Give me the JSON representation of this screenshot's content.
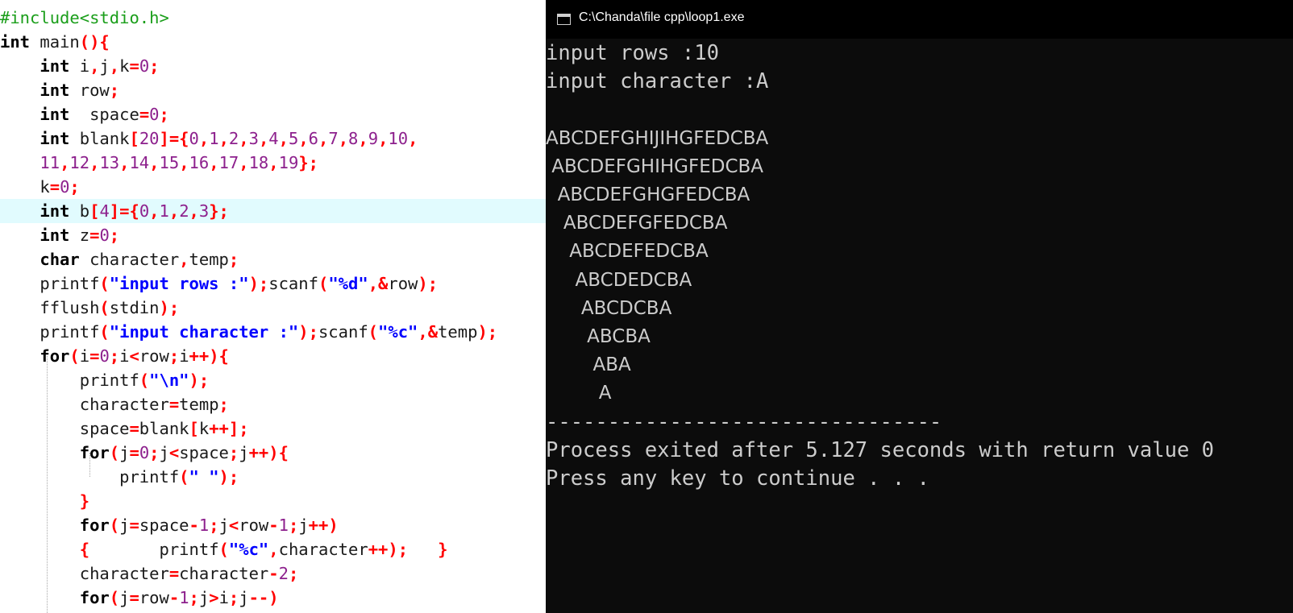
{
  "editor": {
    "lines": [
      [
        {
          "t": "pp",
          "v": "#include<stdio.h>"
        }
      ],
      [
        {
          "t": "kw",
          "v": "int"
        },
        {
          "t": "id",
          "v": " main"
        },
        {
          "t": "op",
          "v": "(){"
        }
      ],
      [
        {
          "t": "id",
          "v": "    "
        },
        {
          "t": "kw",
          "v": "int"
        },
        {
          "t": "id",
          "v": " i"
        },
        {
          "t": "op",
          "v": ","
        },
        {
          "t": "id",
          "v": "j"
        },
        {
          "t": "op",
          "v": ","
        },
        {
          "t": "id",
          "v": "k"
        },
        {
          "t": "op",
          "v": "="
        },
        {
          "t": "num",
          "v": "0"
        },
        {
          "t": "op",
          "v": ";"
        }
      ],
      [
        {
          "t": "id",
          "v": "    "
        },
        {
          "t": "kw",
          "v": "int"
        },
        {
          "t": "id",
          "v": " row"
        },
        {
          "t": "op",
          "v": ";"
        }
      ],
      [
        {
          "t": "id",
          "v": "    "
        },
        {
          "t": "kw",
          "v": "int"
        },
        {
          "t": "id",
          "v": "  space"
        },
        {
          "t": "op",
          "v": "="
        },
        {
          "t": "num",
          "v": "0"
        },
        {
          "t": "op",
          "v": ";"
        }
      ],
      [
        {
          "t": "id",
          "v": "    "
        },
        {
          "t": "kw",
          "v": "int"
        },
        {
          "t": "id",
          "v": " blank"
        },
        {
          "t": "op",
          "v": "["
        },
        {
          "t": "num",
          "v": "20"
        },
        {
          "t": "op",
          "v": "]={"
        },
        {
          "t": "num",
          "v": "0"
        },
        {
          "t": "op",
          "v": ","
        },
        {
          "t": "num",
          "v": "1"
        },
        {
          "t": "op",
          "v": ","
        },
        {
          "t": "num",
          "v": "2"
        },
        {
          "t": "op",
          "v": ","
        },
        {
          "t": "num",
          "v": "3"
        },
        {
          "t": "op",
          "v": ","
        },
        {
          "t": "num",
          "v": "4"
        },
        {
          "t": "op",
          "v": ","
        },
        {
          "t": "num",
          "v": "5"
        },
        {
          "t": "op",
          "v": ","
        },
        {
          "t": "num",
          "v": "6"
        },
        {
          "t": "op",
          "v": ","
        },
        {
          "t": "num",
          "v": "7"
        },
        {
          "t": "op",
          "v": ","
        },
        {
          "t": "num",
          "v": "8"
        },
        {
          "t": "op",
          "v": ","
        },
        {
          "t": "num",
          "v": "9"
        },
        {
          "t": "op",
          "v": ","
        },
        {
          "t": "num",
          "v": "10"
        },
        {
          "t": "op",
          "v": ","
        }
      ],
      [
        {
          "t": "id",
          "v": "    "
        },
        {
          "t": "num",
          "v": "11"
        },
        {
          "t": "op",
          "v": ","
        },
        {
          "t": "num",
          "v": "12"
        },
        {
          "t": "op",
          "v": ","
        },
        {
          "t": "num",
          "v": "13"
        },
        {
          "t": "op",
          "v": ","
        },
        {
          "t": "num",
          "v": "14"
        },
        {
          "t": "op",
          "v": ","
        },
        {
          "t": "num",
          "v": "15"
        },
        {
          "t": "op",
          "v": ","
        },
        {
          "t": "num",
          "v": "16"
        },
        {
          "t": "op",
          "v": ","
        },
        {
          "t": "num",
          "v": "17"
        },
        {
          "t": "op",
          "v": ","
        },
        {
          "t": "num",
          "v": "18"
        },
        {
          "t": "op",
          "v": ","
        },
        {
          "t": "num",
          "v": "19"
        },
        {
          "t": "op",
          "v": "};"
        }
      ],
      [
        {
          "t": "id",
          "v": "    k"
        },
        {
          "t": "op",
          "v": "="
        },
        {
          "t": "num",
          "v": "0"
        },
        {
          "t": "op",
          "v": ";"
        }
      ],
      [
        {
          "t": "id",
          "v": "    "
        },
        {
          "t": "kw",
          "v": "int"
        },
        {
          "t": "id",
          "v": " b"
        },
        {
          "t": "op",
          "v": "["
        },
        {
          "t": "num",
          "v": "4"
        },
        {
          "t": "op",
          "v": "]={"
        },
        {
          "t": "num",
          "v": "0"
        },
        {
          "t": "op",
          "v": ","
        },
        {
          "t": "num",
          "v": "1"
        },
        {
          "t": "op",
          "v": ","
        },
        {
          "t": "num",
          "v": "2"
        },
        {
          "t": "op",
          "v": ","
        },
        {
          "t": "num",
          "v": "3"
        },
        {
          "t": "op",
          "v": "};"
        }
      ],
      [
        {
          "t": "id",
          "v": "    "
        },
        {
          "t": "kw",
          "v": "int"
        },
        {
          "t": "id",
          "v": " z"
        },
        {
          "t": "op",
          "v": "="
        },
        {
          "t": "num",
          "v": "0"
        },
        {
          "t": "op",
          "v": ";"
        }
      ],
      [
        {
          "t": "id",
          "v": "    "
        },
        {
          "t": "kw",
          "v": "char"
        },
        {
          "t": "id",
          "v": " character"
        },
        {
          "t": "op",
          "v": ","
        },
        {
          "t": "id",
          "v": "temp"
        },
        {
          "t": "op",
          "v": ";"
        }
      ],
      [
        {
          "t": "id",
          "v": "    printf"
        },
        {
          "t": "op",
          "v": "("
        },
        {
          "t": "str",
          "v": "\"input rows :\""
        },
        {
          "t": "op",
          "v": ");"
        },
        {
          "t": "id",
          "v": "scanf"
        },
        {
          "t": "op",
          "v": "("
        },
        {
          "t": "str",
          "v": "\"%d\""
        },
        {
          "t": "op",
          "v": ",&"
        },
        {
          "t": "id",
          "v": "row"
        },
        {
          "t": "op",
          "v": ");"
        }
      ],
      [
        {
          "t": "id",
          "v": "    fflush"
        },
        {
          "t": "op",
          "v": "("
        },
        {
          "t": "id",
          "v": "stdin"
        },
        {
          "t": "op",
          "v": ");"
        }
      ],
      [
        {
          "t": "id",
          "v": "    printf"
        },
        {
          "t": "op",
          "v": "("
        },
        {
          "t": "str",
          "v": "\"input character :\""
        },
        {
          "t": "op",
          "v": ");"
        },
        {
          "t": "id",
          "v": "scanf"
        },
        {
          "t": "op",
          "v": "("
        },
        {
          "t": "str",
          "v": "\"%c\""
        },
        {
          "t": "op",
          "v": ",&"
        },
        {
          "t": "id",
          "v": "temp"
        },
        {
          "t": "op",
          "v": ");"
        }
      ],
      [
        {
          "t": "id",
          "v": "    "
        },
        {
          "t": "kw",
          "v": "for"
        },
        {
          "t": "op",
          "v": "("
        },
        {
          "t": "id",
          "v": "i"
        },
        {
          "t": "op",
          "v": "="
        },
        {
          "t": "num",
          "v": "0"
        },
        {
          "t": "op",
          "v": ";"
        },
        {
          "t": "id",
          "v": "i"
        },
        {
          "t": "op",
          "v": "<"
        },
        {
          "t": "id",
          "v": "row"
        },
        {
          "t": "op",
          "v": ";"
        },
        {
          "t": "id",
          "v": "i"
        },
        {
          "t": "op",
          "v": "++){"
        }
      ],
      [
        {
          "t": "id",
          "v": "        printf"
        },
        {
          "t": "op",
          "v": "("
        },
        {
          "t": "str",
          "v": "\"\\n\""
        },
        {
          "t": "op",
          "v": ");"
        }
      ],
      [
        {
          "t": "id",
          "v": "        character"
        },
        {
          "t": "op",
          "v": "="
        },
        {
          "t": "id",
          "v": "temp"
        },
        {
          "t": "op",
          "v": ";"
        }
      ],
      [
        {
          "t": "id",
          "v": "        space"
        },
        {
          "t": "op",
          "v": "="
        },
        {
          "t": "id",
          "v": "blank"
        },
        {
          "t": "op",
          "v": "["
        },
        {
          "t": "id",
          "v": "k"
        },
        {
          "t": "op",
          "v": "++];"
        }
      ],
      [
        {
          "t": "id",
          "v": "        "
        },
        {
          "t": "kw",
          "v": "for"
        },
        {
          "t": "op",
          "v": "("
        },
        {
          "t": "id",
          "v": "j"
        },
        {
          "t": "op",
          "v": "="
        },
        {
          "t": "num",
          "v": "0"
        },
        {
          "t": "op",
          "v": ";"
        },
        {
          "t": "id",
          "v": "j"
        },
        {
          "t": "op",
          "v": "<"
        },
        {
          "t": "id",
          "v": "space"
        },
        {
          "t": "op",
          "v": ";"
        },
        {
          "t": "id",
          "v": "j"
        },
        {
          "t": "op",
          "v": "++){"
        }
      ],
      [
        {
          "t": "id",
          "v": "            printf"
        },
        {
          "t": "op",
          "v": "("
        },
        {
          "t": "str",
          "v": "\" \""
        },
        {
          "t": "op",
          "v": ");"
        }
      ],
      [
        {
          "t": "id",
          "v": "        "
        },
        {
          "t": "op",
          "v": "}"
        }
      ],
      [
        {
          "t": "id",
          "v": "        "
        },
        {
          "t": "kw",
          "v": "for"
        },
        {
          "t": "op",
          "v": "("
        },
        {
          "t": "id",
          "v": "j"
        },
        {
          "t": "op",
          "v": "="
        },
        {
          "t": "id",
          "v": "space"
        },
        {
          "t": "op",
          "v": "-"
        },
        {
          "t": "num",
          "v": "1"
        },
        {
          "t": "op",
          "v": ";"
        },
        {
          "t": "id",
          "v": "j"
        },
        {
          "t": "op",
          "v": "<"
        },
        {
          "t": "id",
          "v": "row"
        },
        {
          "t": "op",
          "v": "-"
        },
        {
          "t": "num",
          "v": "1"
        },
        {
          "t": "op",
          "v": ";"
        },
        {
          "t": "id",
          "v": "j"
        },
        {
          "t": "op",
          "v": "++)"
        }
      ],
      [
        {
          "t": "id",
          "v": "        "
        },
        {
          "t": "op",
          "v": "{"
        },
        {
          "t": "id",
          "v": "       printf"
        },
        {
          "t": "op",
          "v": "("
        },
        {
          "t": "str",
          "v": "\"%c\""
        },
        {
          "t": "op",
          "v": ","
        },
        {
          "t": "id",
          "v": "character"
        },
        {
          "t": "op",
          "v": "++);"
        },
        {
          "t": "id",
          "v": "   "
        },
        {
          "t": "op",
          "v": "}"
        }
      ],
      [
        {
          "t": "id",
          "v": "        character"
        },
        {
          "t": "op",
          "v": "="
        },
        {
          "t": "id",
          "v": "character"
        },
        {
          "t": "op",
          "v": "-"
        },
        {
          "t": "num",
          "v": "2"
        },
        {
          "t": "op",
          "v": ";"
        }
      ],
      [
        {
          "t": "id",
          "v": "        "
        },
        {
          "t": "kw",
          "v": "for"
        },
        {
          "t": "op",
          "v": "("
        },
        {
          "t": "id",
          "v": "j"
        },
        {
          "t": "op",
          "v": "="
        },
        {
          "t": "id",
          "v": "row"
        },
        {
          "t": "op",
          "v": "-"
        },
        {
          "t": "num",
          "v": "1"
        },
        {
          "t": "op",
          "v": ";"
        },
        {
          "t": "id",
          "v": "j"
        },
        {
          "t": "op",
          "v": ">"
        },
        {
          "t": "id",
          "v": "i"
        },
        {
          "t": "op",
          "v": ";"
        },
        {
          "t": "id",
          "v": "j"
        },
        {
          "t": "op",
          "v": "--)"
        }
      ]
    ],
    "highlighted_line": 8
  },
  "console": {
    "title": "C:\\Chanda\\file cpp\\loop1.exe",
    "lines": [
      {
        "text": "input rows :10",
        "font": "mono"
      },
      {
        "text": "input character :A",
        "font": "mono"
      },
      {
        "text": "",
        "font": "mono"
      },
      {
        "text": "ABCDEFGHIJIHGFEDCBA",
        "font": "prop"
      },
      {
        "text": " ABCDEFGHIHGFEDCBA",
        "font": "prop"
      },
      {
        "text": "  ABCDEFGHGFEDCBA",
        "font": "prop"
      },
      {
        "text": "   ABCDEFGFEDCBA",
        "font": "prop"
      },
      {
        "text": "    ABCDEFEDCBA",
        "font": "prop"
      },
      {
        "text": "     ABCDEDCBA",
        "font": "prop"
      },
      {
        "text": "      ABCDCBA",
        "font": "prop"
      },
      {
        "text": "       ABCBA",
        "font": "prop"
      },
      {
        "text": "        ABA",
        "font": "prop"
      },
      {
        "text": "         A",
        "font": "prop"
      },
      {
        "text": "--------------------------------",
        "font": "mono"
      },
      {
        "text": "Process exited after 5.127 seconds with return value 0",
        "font": "mono"
      },
      {
        "text": "Press any key to continue . . .",
        "font": "mono"
      }
    ]
  }
}
